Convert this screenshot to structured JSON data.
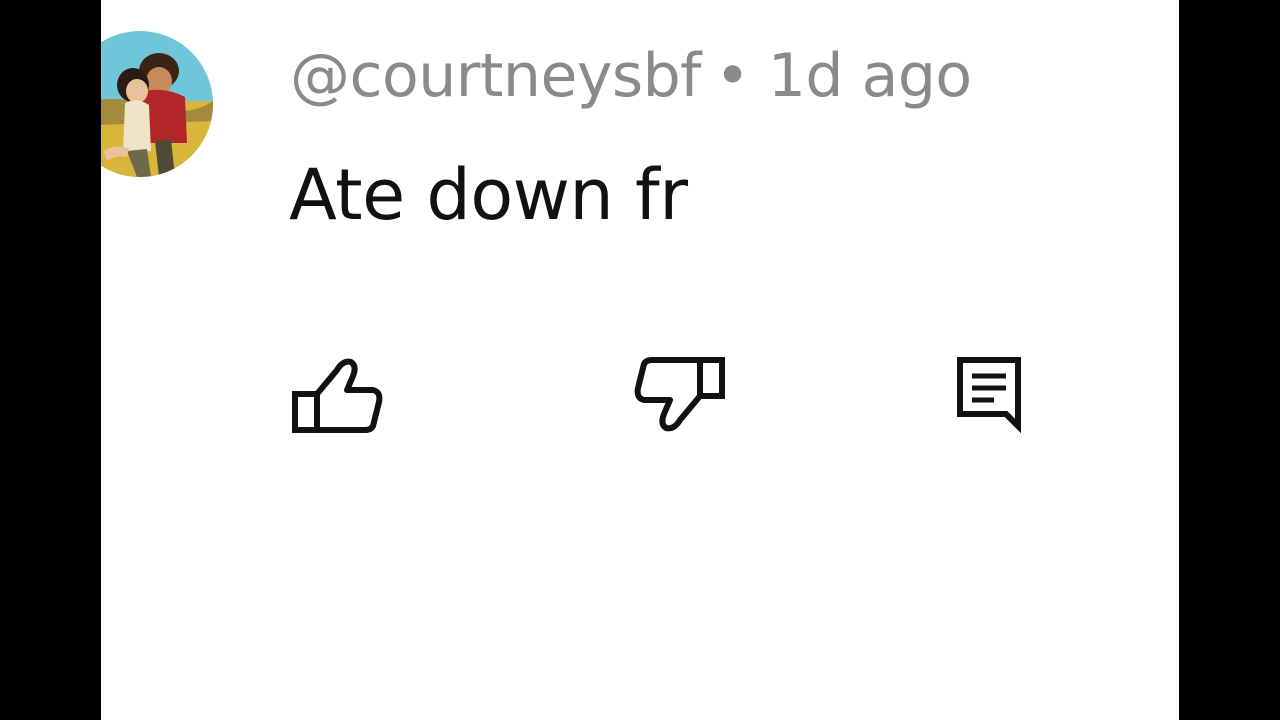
{
  "comment": {
    "username": "@courtneysbf",
    "separator": "•",
    "timestamp": "1d ago",
    "text": "Ate down fr"
  },
  "actions": {
    "like_icon": "thumbs-up-icon",
    "dislike_icon": "thumbs-down-icon",
    "reply_icon": "comment-reply-icon"
  },
  "colors": {
    "background": "#ffffff",
    "letterbox": "#000000",
    "meta_text": "#8a8a8a",
    "body_text": "#111111",
    "icon_stroke": "#111111"
  }
}
